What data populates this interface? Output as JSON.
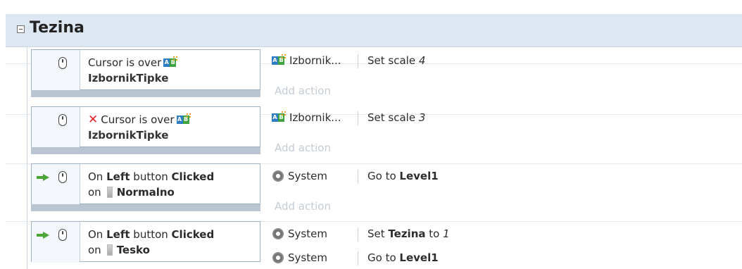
{
  "group": {
    "title": "Tezina"
  },
  "events": [
    {
      "trigger_prefix": "",
      "negated": false,
      "cond_text": "Cursor is over",
      "object": "IzbornikTipke",
      "actions": [
        {
          "object": "Izbornik...",
          "text": "Set scale ",
          "value": "4"
        }
      ],
      "add_action": "Add action"
    },
    {
      "negated": true,
      "cond_text": "Cursor is over",
      "object": "IzbornikTipke",
      "actions": [
        {
          "object": "Izbornik...",
          "text": "Set scale ",
          "value": "3"
        }
      ],
      "add_action": "Add action"
    },
    {
      "cond_prefix": "On ",
      "cond_button": "Left",
      "cond_mid": " button ",
      "cond_action": "Clicked",
      "cond_on": "on",
      "object": "Normalno",
      "actions": [
        {
          "object": "System",
          "text": "Go to ",
          "target": "Level1"
        }
      ],
      "add_action": "Add action"
    },
    {
      "cond_prefix": "On ",
      "cond_button": "Left",
      "cond_mid": " button ",
      "cond_action": "Clicked",
      "cond_on": "on",
      "object": "Tesko",
      "actions": [
        {
          "object": "System",
          "text_prefix": "Set ",
          "var": "Tezina",
          "text_mid": " to ",
          "value": "1"
        },
        {
          "object": "System",
          "text": "Go to ",
          "target": "Level1"
        }
      ]
    }
  ]
}
